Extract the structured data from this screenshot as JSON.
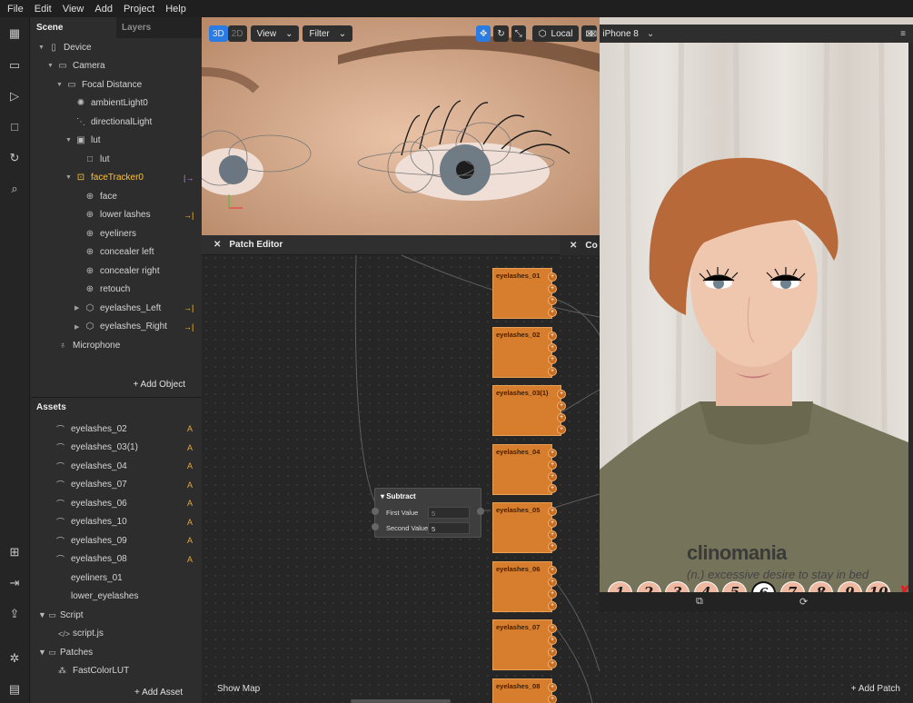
{
  "menu": [
    "File",
    "Edit",
    "View",
    "Add",
    "Project",
    "Help"
  ],
  "scene": {
    "tabs": [
      "Scene",
      "Layers"
    ],
    "tree": [
      {
        "label": "Device",
        "icon": "device-icon",
        "depth": 0,
        "expanded": true
      },
      {
        "label": "Camera",
        "icon": "camera-icon",
        "depth": 1,
        "expanded": true
      },
      {
        "label": "Focal Distance",
        "icon": "focal-icon",
        "depth": 2,
        "expanded": true
      },
      {
        "label": "ambientLight0",
        "icon": "ambient-light-icon",
        "depth": 3
      },
      {
        "label": "directionalLight",
        "icon": "directional-light-icon",
        "depth": 3
      },
      {
        "label": "lut",
        "icon": "rectangle-icon",
        "depth": 3,
        "expanded": true
      },
      {
        "label": "lut",
        "icon": "plane-icon",
        "depth": 4
      },
      {
        "label": "faceTracker0",
        "icon": "face-tracker-icon",
        "depth": 3,
        "expanded": true,
        "selected": true,
        "badge": "|→"
      },
      {
        "label": "face",
        "icon": "mesh-icon",
        "depth": 4
      },
      {
        "label": "lower lashes",
        "icon": "mesh-icon",
        "depth": 4,
        "badge": "→|"
      },
      {
        "label": "eyeliners",
        "icon": "mesh-icon",
        "depth": 4
      },
      {
        "label": "concealer left",
        "icon": "mesh-icon",
        "depth": 4
      },
      {
        "label": "concealer right",
        "icon": "mesh-icon",
        "depth": 4
      },
      {
        "label": "retouch",
        "icon": "mesh-icon",
        "depth": 4
      },
      {
        "label": "eyelashes_Left",
        "icon": "cube-icon",
        "depth": 4,
        "collapsed": true,
        "badge": "→|"
      },
      {
        "label": "eyelashes_Right",
        "icon": "cube-icon",
        "depth": 4,
        "collapsed": true,
        "badge": "→|"
      },
      {
        "label": "Microphone",
        "icon": "microphone-icon",
        "depth": 1
      }
    ],
    "add_object": "+ Add Object"
  },
  "assets": {
    "title": "Assets",
    "items": [
      {
        "label": "eyelashes_02",
        "flag": "A",
        "icon": "eyelash-asset-icon"
      },
      {
        "label": "eyelashes_03(1)",
        "flag": "A",
        "icon": "eyelash-asset-icon"
      },
      {
        "label": "eyelashes_04",
        "flag": "A",
        "icon": "eyelash-asset-icon"
      },
      {
        "label": "eyelashes_07",
        "flag": "A",
        "icon": "eyelash-asset-icon"
      },
      {
        "label": "eyelashes_06",
        "flag": "A",
        "icon": "eyelash-asset-icon"
      },
      {
        "label": "eyelashes_10",
        "flag": "A",
        "icon": "eyelash-asset-icon"
      },
      {
        "label": "eyelashes_09",
        "flag": "A",
        "icon": "eyelash-asset-icon"
      },
      {
        "label": "eyelashes_08",
        "flag": "A",
        "icon": "eyelash-asset-icon"
      },
      {
        "label": "eyeliners_01",
        "flag": "",
        "icon": ""
      },
      {
        "label": "lower_eyelashes",
        "flag": "",
        "icon": ""
      },
      {
        "label": "Script",
        "flag": "",
        "icon": "folder-icon",
        "folder": true
      },
      {
        "label": "script.js",
        "flag": "",
        "icon": "code-icon",
        "child": true
      },
      {
        "label": "Patches",
        "flag": "",
        "icon": "folder-icon",
        "folder": true
      },
      {
        "label": "FastColorLUT",
        "flag": "",
        "icon": "patch-icon",
        "child": true
      }
    ],
    "add_asset": "+ Add Asset"
  },
  "viewport": {
    "mode3d": "3D",
    "mode2d": "2D",
    "view": "View",
    "filter": "Filter",
    "local": "Local"
  },
  "simulator": {
    "device": "iPhone 8"
  },
  "patch_editor": {
    "title": "Patch Editor",
    "second_title": "Co",
    "show_map": "Show Map",
    "add_patch": "+ Add Patch",
    "nodes": [
      "eyelashes_01",
      "eyelashes_02",
      "eyelashes_03(1)",
      "eyelashes_04",
      "eyelashes_05",
      "eyelashes_06",
      "eyelashes_07",
      "eyelashes_08"
    ],
    "subtract": {
      "title": "Subtract",
      "first_label": "First Value",
      "first_value": "5",
      "second_label": "Second Value",
      "second_value": "5"
    }
  },
  "effect": {
    "word": "clinomania",
    "definition": "(n.) excessive desire to stay in bed",
    "numbers": [
      "1",
      "2",
      "3",
      "4",
      "5",
      "6",
      "7",
      "8",
      "9",
      "10"
    ],
    "selected": "6",
    "close": "✗"
  },
  "colors": {
    "accent": "#2a7be2",
    "selected": "#ffc233",
    "patch": "#d77d2e"
  }
}
